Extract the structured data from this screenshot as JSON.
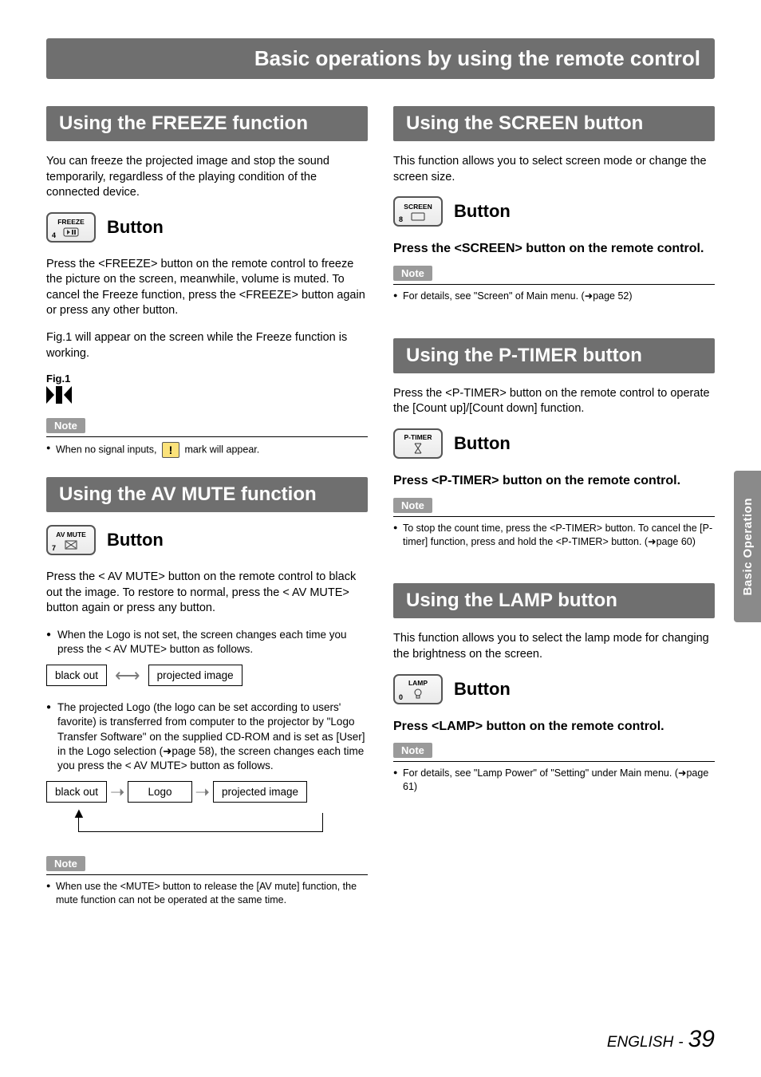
{
  "header": {
    "title": "Basic operations by using the remote control"
  },
  "side_tab": {
    "label": "Basic Operation"
  },
  "footer": {
    "language": "ENGLISH",
    "separator": "-",
    "page_number": "39"
  },
  "left": {
    "freeze": {
      "heading": "Using the FREEZE function",
      "intro": "You can freeze the projected image and stop the sound temporarily, regardless of the playing condition of the connected device.",
      "button_icon": {
        "label": "FREEZE",
        "number": "4",
        "name": "freeze-button-icon"
      },
      "button_text": "Button",
      "body1": "Press the <FREEZE> button on the remote control to freeze the picture on the screen, meanwhile, volume is muted. To cancel the Freeze function, press the <FREEZE> button again or press any other button.",
      "body2": "Fig.1 will appear on the screen while the Freeze function is working.",
      "fig_label": "Fig.1",
      "note_tag": "Note",
      "note_pre": "When no signal inputs,",
      "note_post": " mark will appear."
    },
    "avmute": {
      "heading": "Using the AV MUTE function",
      "button_icon": {
        "label": "AV MUTE",
        "number": "7",
        "name": "av-mute-button-icon"
      },
      "button_text": "Button",
      "body1": "Press the < AV MUTE> button on the remote control to black out the image. To restore to normal, press the < AV MUTE> button again or press any button.",
      "bullet1": "When the Logo is not set, the screen changes each time you press the < AV MUTE> button as follows.",
      "flow2": {
        "a": "black out",
        "b": "projected image"
      },
      "bullet2": "The projected Logo (the logo can be set according to users' favorite) is transferred from computer to the projector by \"Logo Transfer Software\" on the supplied CD-ROM and is set as [User] in the Logo selection (➜page 58), the screen changes each time you press the < AV MUTE> button as follows.",
      "flow3": {
        "a": "black out",
        "b": "Logo",
        "c": "projected image"
      },
      "note_tag": "Note",
      "note1": "When use the <MUTE> button to release the [AV mute] function, the mute function can not be operated at the same time."
    }
  },
  "right": {
    "screen": {
      "heading": "Using the SCREEN button",
      "intro": "This function allows you to select screen mode or change the screen size.",
      "button_icon": {
        "label": "SCREEN",
        "number": "8",
        "name": "screen-button-icon"
      },
      "button_text": "Button",
      "instr": "Press the <SCREEN> button on the remote control.",
      "note_tag": "Note",
      "note1": "For details, see \"Screen\" of Main menu. (➜page 52)"
    },
    "ptimer": {
      "heading": "Using the P-TIMER button",
      "intro": "Press the <P-TIMER> button on the remote control to operate the [Count up]/[Count down] function.",
      "button_icon": {
        "label": "P-TIMER",
        "number": "",
        "name": "ptimer-button-icon"
      },
      "button_text": "Button",
      "instr": "Press <P-TIMER> button on the remote control.",
      "note_tag": "Note",
      "note1": "To stop the count time, press the <P-TIMER> button. To cancel the [P-timer] function, press and hold the <P-TIMER> button. (➜page 60)"
    },
    "lamp": {
      "heading": "Using the LAMP button",
      "intro": "This function allows you to select the lamp mode for changing the brightness on the screen.",
      "button_icon": {
        "label": "LAMP",
        "number": "0",
        "name": "lamp-button-icon"
      },
      "button_text": "Button",
      "instr": "Press <LAMP> button on the remote control.",
      "note_tag": "Note",
      "note1": "For details, see \"Lamp Power\" of \"Setting\" under Main menu. (➜page 61)"
    }
  }
}
